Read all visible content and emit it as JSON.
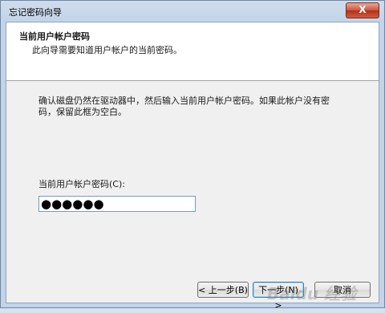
{
  "window": {
    "title": "忘记密码向导",
    "close_symbol": "X"
  },
  "header": {
    "title": "当前用户帐户密码",
    "subtitle": "此向导需要知道用户帐户的当前密码。"
  },
  "body": {
    "description": "确认磁盘仍然在驱动器中，然后输入当前用户帐户密码。如果此帐户没有密码，保留此框为空白。",
    "password_label": "当前用户帐户密码(C):",
    "password_value": "●●●●●●"
  },
  "buttons": {
    "back": "< 上一步(B)",
    "next": "下一步(N) >",
    "cancel": "取消"
  },
  "watermark": {
    "text": "Baidu 经验"
  }
}
